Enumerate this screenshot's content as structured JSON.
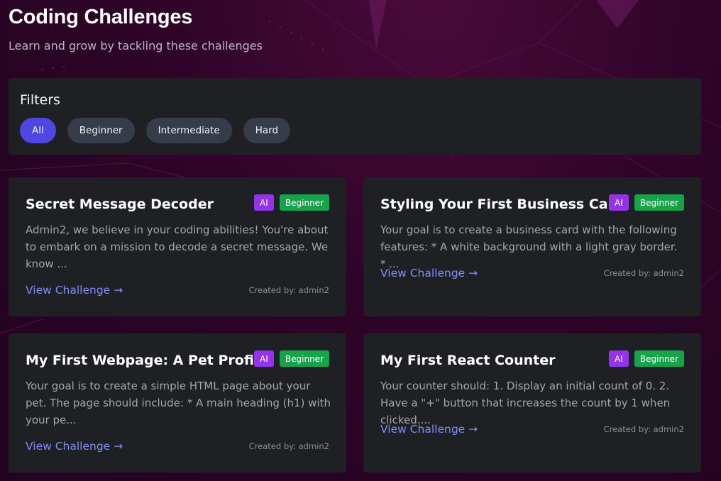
{
  "header": {
    "title": "Coding Challenges",
    "subtitle": "Learn and grow by tackling these challenges"
  },
  "filters": {
    "heading": "Filters",
    "options": [
      {
        "label": "All",
        "active": true
      },
      {
        "label": "Beginner",
        "active": false
      },
      {
        "label": "Intermediate",
        "active": false
      },
      {
        "label": "Hard",
        "active": false
      }
    ]
  },
  "challenges": [
    {
      "title": "Secret Message Decoder",
      "ai_badge": "AI",
      "level": "Beginner",
      "description": "Admin2, we believe in your coding abilities! You're about to embark on a mission to decode a secret message. We know ...",
      "link_label": "View Challenge →",
      "created_by": "Created by: admin2"
    },
    {
      "title": "Styling Your First Business Card",
      "ai_badge": "AI",
      "level": "Beginner",
      "description": "Your goal is to create a business card with the following features: * A white background with a light gray border. * ...",
      "link_label": "View Challenge →",
      "created_by": "Created by: admin2"
    },
    {
      "title": "My First Webpage: A Pet Profile",
      "ai_badge": "AI",
      "level": "Beginner",
      "description": "Your goal is to create a simple HTML page about your pet. The page should include: * A main heading (h1) with your pe...",
      "link_label": "View Challenge →",
      "created_by": "Created by: admin2"
    },
    {
      "title": "My First React Counter",
      "ai_badge": "AI",
      "level": "Beginner",
      "description": "Your counter should: 1. Display an initial count of 0. 2. Have a \"+\" button that increases the count by 1 when clicked....",
      "link_label": "View Challenge →",
      "created_by": "Created by: admin2"
    }
  ],
  "colors": {
    "accent": "#5046e5",
    "link": "#818cf8",
    "ai_badge": "#9333ea",
    "level_badge": "#16a34a",
    "card_bg": "#1f2023"
  }
}
